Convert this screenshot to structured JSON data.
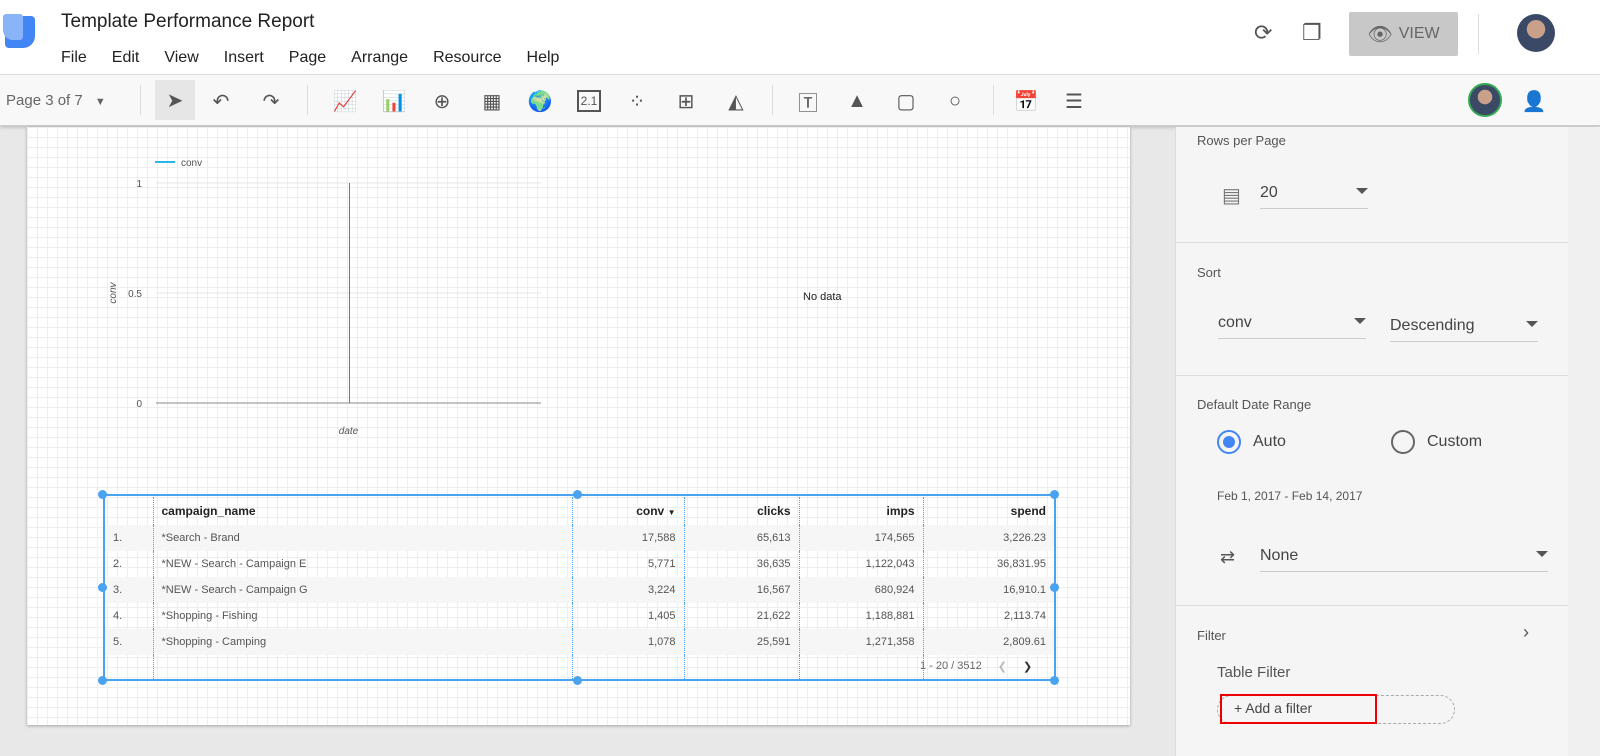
{
  "app": {
    "title": "Template Performance Report",
    "menu": [
      "File",
      "Edit",
      "View",
      "Insert",
      "Page",
      "Arrange",
      "Resource",
      "Help"
    ],
    "view_label": "VIEW"
  },
  "toolbar": {
    "page_selector": "Page 3 of 7",
    "scorecard_glyph": "2.1"
  },
  "chart_data": {
    "type": "line",
    "legend": [
      "conv"
    ],
    "series": [
      {
        "name": "conv",
        "values": []
      }
    ],
    "ylabel": "conv",
    "xlabel": "date",
    "yticks": [
      "1",
      "0.5",
      "0"
    ],
    "ylim": [
      0,
      1
    ],
    "grid": true,
    "legend_position": "top-left"
  },
  "no_data": "No data",
  "table": {
    "columns": [
      "campaign_name",
      "conv",
      "clicks",
      "imps",
      "spend"
    ],
    "sort_indicator": "▼",
    "rows": [
      [
        "1.",
        "*Search - Brand",
        "17,588",
        "65,613",
        "174,565",
        "3,226.23"
      ],
      [
        "2.",
        "*NEW - Search - Campaign E",
        "5,771",
        "36,635",
        "1,122,043",
        "36,831.95"
      ],
      [
        "3.",
        "*NEW - Search - Campaign G",
        "3,224",
        "16,567",
        "680,924",
        "16,910.1"
      ],
      [
        "4.",
        "*Shopping - Fishing",
        "1,405",
        "21,622",
        "1,188,881",
        "2,113.74"
      ],
      [
        "5.",
        "*Shopping - Camping",
        "1,078",
        "25,591",
        "1,271,358",
        "2,809.61"
      ]
    ],
    "pagination": "1 - 20 / 3512"
  },
  "panel": {
    "rows_per_page_label": "Rows per Page",
    "rows_per_page": "20",
    "sort_label": "Sort",
    "sort_field": "conv",
    "sort_order": "Descending",
    "date_range_label": "Default Date Range",
    "auto": "Auto",
    "custom": "Custom",
    "date_range": "Feb 1, 2017 - Feb 14, 2017",
    "comparison": "None",
    "filter_label": "Filter",
    "table_filter": "Table Filter",
    "add_filter": "+ Add a filter"
  },
  "colors": {
    "accent": "#4aa3f0",
    "series": "#29b6e8"
  }
}
